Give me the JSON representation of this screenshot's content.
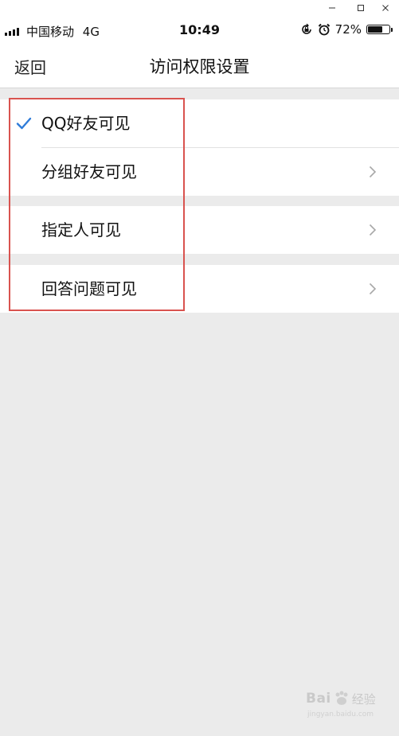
{
  "status_bar": {
    "carrier": "中国移动",
    "network": "4G",
    "time": "10:49",
    "battery_percent_label": "72%",
    "battery_level": 0.72
  },
  "nav": {
    "back_label": "返回",
    "title": "访问权限设置"
  },
  "options": [
    {
      "label": "QQ好友可见",
      "selected": true,
      "has_arrow": false
    },
    {
      "label": "分组好友可见",
      "selected": false,
      "has_arrow": true
    },
    {
      "label": "指定人可见",
      "selected": false,
      "has_arrow": true
    },
    {
      "label": "回答问题可见",
      "selected": false,
      "has_arrow": true
    }
  ],
  "colors": {
    "checkmark": "#2f7cd9",
    "annotation_border": "#d9534f",
    "background": "#ebebeb"
  },
  "icons": {
    "check": "checkmark-icon",
    "arrow": "chevron-right-icon"
  },
  "watermark": {
    "text": "Bai",
    "suffix": "经验",
    "sub": "jingyan.baidu.com"
  }
}
